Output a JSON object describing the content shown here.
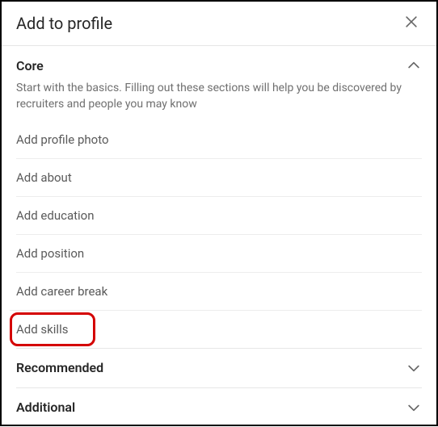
{
  "header": {
    "title": "Add to profile"
  },
  "core": {
    "title": "Core",
    "description": "Start with the basics. Filling out these sections will help you be discovered by recruiters and people you may know",
    "items": [
      {
        "label": "Add profile photo"
      },
      {
        "label": "Add about"
      },
      {
        "label": "Add education"
      },
      {
        "label": "Add position"
      },
      {
        "label": "Add career break"
      },
      {
        "label": "Add skills"
      }
    ]
  },
  "recommended": {
    "title": "Recommended"
  },
  "additional": {
    "title": "Additional"
  }
}
